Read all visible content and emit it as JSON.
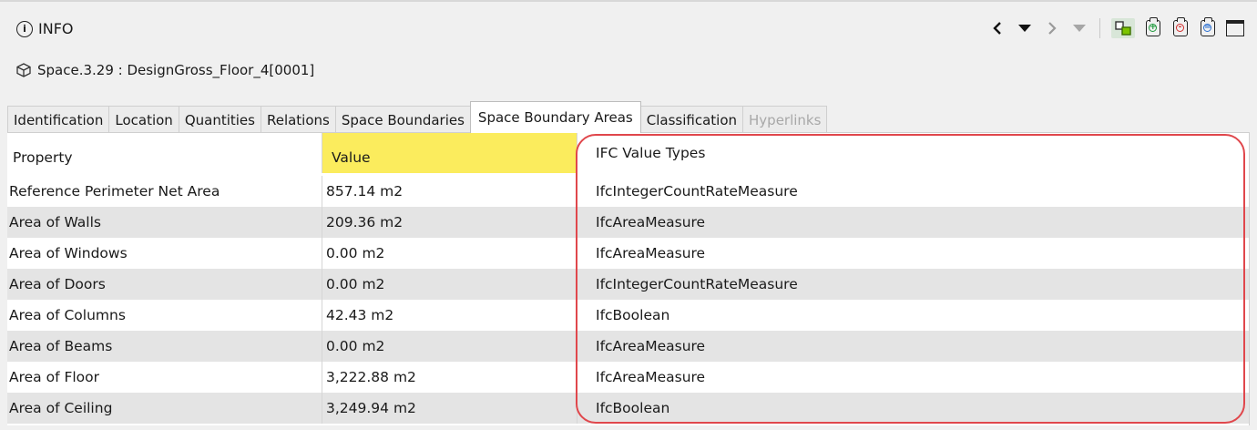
{
  "header": {
    "title": "INFO",
    "object_label": "Space.3.29 : DesignGross_Floor_4[0001]"
  },
  "toolbar": {
    "icons": [
      "back-icon",
      "history-back-dropdown-icon",
      "forward-icon",
      "history-forward-dropdown-icon",
      "link-selection-icon",
      "add-property-icon",
      "remove-property-icon",
      "edit-property-icon",
      "window-icon"
    ]
  },
  "tabs": [
    {
      "label": "Identification",
      "state": "normal"
    },
    {
      "label": "Location",
      "state": "normal"
    },
    {
      "label": "Quantities",
      "state": "normal"
    },
    {
      "label": "Relations",
      "state": "normal"
    },
    {
      "label": "Space Boundaries",
      "state": "normal"
    },
    {
      "label": "Space Boundary Areas",
      "state": "active"
    },
    {
      "label": "Classification",
      "state": "normal"
    },
    {
      "label": "Hyperlinks",
      "state": "disabled"
    }
  ],
  "table": {
    "columns": [
      "Property",
      "Value",
      "IFC Value Types"
    ],
    "rows": [
      {
        "property": "Reference Perimeter Net Area",
        "value": "857.14 m2",
        "type": "IfcIntegerCountRateMeasure"
      },
      {
        "property": "Area of Walls",
        "value": "209.36 m2",
        "type": "IfcAreaMeasure"
      },
      {
        "property": "Area of Windows",
        "value": "0.00 m2",
        "type": "IfcAreaMeasure"
      },
      {
        "property": "Area of Doors",
        "value": "0.00 m2",
        "type": "IfcIntegerCountRateMeasure"
      },
      {
        "property": "Area of Columns",
        "value": "42.43 m2",
        "type": "IfcBoolean"
      },
      {
        "property": "Area of Beams",
        "value": "0.00 m2",
        "type": "IfcAreaMeasure"
      },
      {
        "property": "Area of Floor",
        "value": "3,222.88 m2",
        "type": "IfcAreaMeasure"
      },
      {
        "property": "Area of Ceiling",
        "value": "3,249.94 m2",
        "type": "IfcBoolean"
      }
    ]
  },
  "colors": {
    "value_header_highlight": "#fbec5d",
    "annotation_outline": "#e0474c",
    "add_icon": "#1e9a3c",
    "remove_icon": "#d02a2a",
    "edit_icon": "#2a6fd0"
  }
}
